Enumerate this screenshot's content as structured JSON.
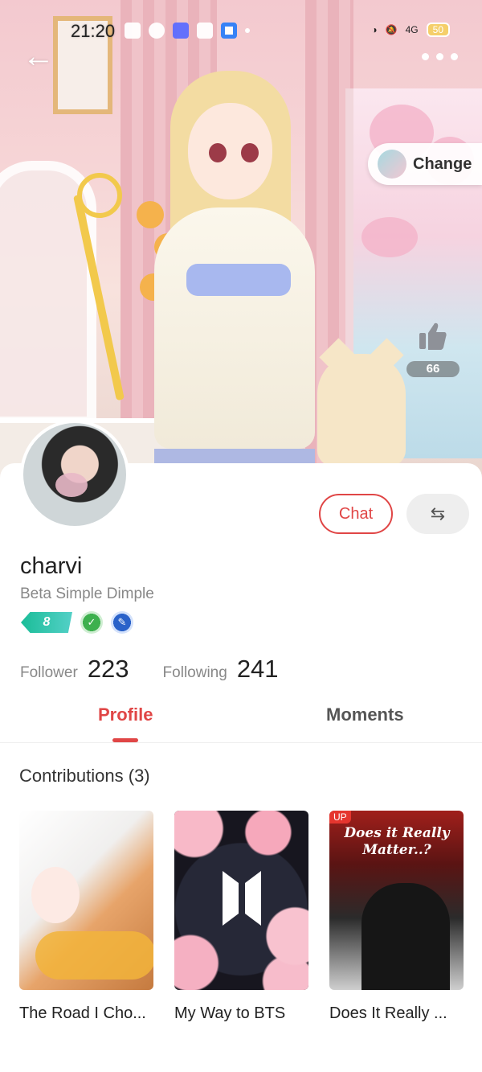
{
  "status_bar": {
    "time": "21:20",
    "battery": "50",
    "network": "4G"
  },
  "header": {
    "back_icon": "arrow-left-icon",
    "more_icon": "more-dots-icon",
    "change_label": "Change",
    "likes": "66"
  },
  "profile": {
    "username": "charvi",
    "subtitle": "Beta Simple Dimple",
    "level": "8",
    "chat_label": "Chat",
    "follower_label": "Follower",
    "follower_count": "223",
    "following_label": "Following",
    "following_count": "241"
  },
  "tabs": [
    {
      "label": "Profile",
      "active": true
    },
    {
      "label": "Moments",
      "active": false
    }
  ],
  "contributions": {
    "title": "Contributions (3)",
    "items": [
      {
        "title": "The Road I Cho...",
        "badge": ""
      },
      {
        "title": "My Way to BTS",
        "badge": ""
      },
      {
        "title": "Does It Really ...",
        "badge": "UP",
        "cover_text": "Does it Really Matter..?"
      }
    ]
  },
  "colors": {
    "accent": "#e04646",
    "level_badge": "#1bbd98"
  }
}
